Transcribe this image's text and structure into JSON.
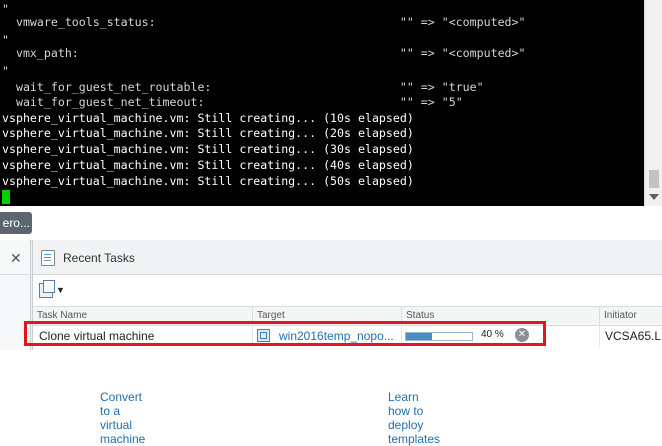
{
  "terminal": {
    "lines": [
      {
        "text": "\"",
        "color": "#d4d4d4"
      },
      {
        "text": "  vmware_tools_status:                                   \"\" => \"<computed>\"",
        "color": "#d4d4d4"
      },
      {
        "text": "\"",
        "color": "#d4d4d4"
      },
      {
        "text": "  vmx_path:                                              \"\" => \"<computed>\"",
        "color": "#d4d4d4"
      },
      {
        "text": "\"",
        "color": "#d4d4d4"
      },
      {
        "text": "  wait_for_guest_net_routable:                           \"\" => \"true\"",
        "color": "#d4d4d4"
      },
      {
        "text": "  wait_for_guest_net_timeout:                            \"\" => \"5\"",
        "color": "#d4d4d4"
      },
      {
        "text": "vsphere_virtual_machine.vm: Still creating... (10s elapsed)",
        "color": "#ffffff"
      },
      {
        "text": "vsphere_virtual_machine.vm: Still creating... (20s elapsed)",
        "color": "#ffffff"
      },
      {
        "text": "vsphere_virtual_machine.vm: Still creating... (30s elapsed)",
        "color": "#ffffff"
      },
      {
        "text": "vsphere_virtual_machine.vm: Still creating... (40s elapsed)",
        "color": "#ffffff"
      },
      {
        "text": "vsphere_virtual_machine.vm: Still creating... (50s elapsed)",
        "color": "#ffffff"
      }
    ],
    "cursor_color": "#00d000"
  },
  "background": {
    "hint_left": "Convert to a virtual machine",
    "hint_right": "Learn how to deploy templates",
    "button_fragment": "ero..."
  },
  "left_pane": {
    "close_glyph": "✕"
  },
  "recent_tasks": {
    "title": "Recent Tasks",
    "columns": [
      "Task Name",
      "Target",
      "Status",
      "Initiator"
    ],
    "rows": [
      {
        "task_name": "Clone virtual machine",
        "target": "win2016temp_nopo...",
        "progress": 0.4,
        "status_text": "40 %",
        "initiator": "VCSA65.L"
      }
    ]
  },
  "colors": {
    "highlight": "#e3161c",
    "link": "#1f6fb2",
    "progress": "#4a8bc2"
  }
}
